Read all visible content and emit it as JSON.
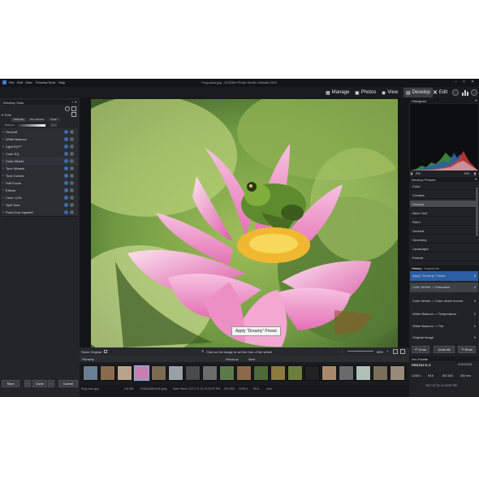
{
  "window": {
    "title": "Frog-lotus.jpg - ACDSee Photo Studio Ultimate 2021",
    "menus": [
      "File",
      "Edit",
      "View",
      "Process",
      "Tools",
      "Help"
    ]
  },
  "modes": {
    "manage": "Manage",
    "photos": "Photos",
    "view": "View",
    "develop": "Develop",
    "edit": "Edit"
  },
  "left": {
    "panel_title": "Develop Tools",
    "tune_label": "Tune",
    "tabs": [
      "Whitebal",
      "Tone Wheels",
      "Detail"
    ],
    "slider_label": "Brilliance",
    "tools": [
      "General",
      "White Balance",
      "Light EQ™",
      "Color EQ",
      "Color Wheel",
      "Tone Wheels",
      "Tone Curves",
      "Soft Focus",
      "Effects",
      "Color LUTs",
      "Split Tone",
      "Post-Crop Vignette"
    ],
    "buttons": {
      "save": "Save",
      "done": "Done",
      "cancel": "Cancel"
    }
  },
  "center": {
    "show_original": "Show Original",
    "hint": "Click on the image to set the hue of the wheel",
    "zoom": "66%",
    "tooltip": "Apply \"Dreamy\" Preset",
    "filmstrip_label": "Filmstrip",
    "filmstrip_nav": [
      "Previous",
      "Next"
    ],
    "status_file": "Frog-lotus.jpg",
    "status_items": [
      "3.8 MB",
      "5184x3456x24b jpeg",
      "Date Taken: 2017-07-31 12:34:57 PM",
      "ISO 800",
      "1/250 s",
      "f/5.6",
      "Auto"
    ]
  },
  "right": {
    "histogram_title": "Histogram",
    "hist_left": "0%",
    "hist_right": "0%",
    "presets_title": "Develop Presets",
    "presets": [
      {
        "label": "Color",
        "selected": false
      },
      {
        "label": "Creative",
        "selected": false
      },
      {
        "label": "Dreamy",
        "selected": true
      },
      {
        "label": "Neon York",
        "selected": false
      },
      {
        "label": "Retro",
        "selected": false
      },
      {
        "label": "General",
        "selected": false
      },
      {
        "label": "Geometry",
        "selected": false
      },
      {
        "label": "Landscape",
        "selected": false
      },
      {
        "label": "Portrait",
        "selected": false
      }
    ],
    "history_tabs": [
      "History",
      "Snapshots"
    ],
    "history": [
      {
        "label": "Apply \"Dreamy\" Preset",
        "num": "5",
        "state": "active"
      },
      {
        "label": "Color Wheel -> Saturation",
        "num": "4",
        "state": "sel"
      },
      {
        "label": "Color Wheel -> Color wheel moved",
        "num": "3",
        "state": "normal"
      },
      {
        "label": "White Balance -> Temperature",
        "num": "2",
        "state": "normal"
      },
      {
        "label": "White Balance -> Tint",
        "num": "1",
        "state": "normal"
      },
      {
        "label": "Original Image",
        "num": "0",
        "state": "normal"
      }
    ],
    "undo": "Undo",
    "undo_all": "Undo All",
    "redo": "Redo",
    "info_title": "Info Palette",
    "camera": "PENTAX K-3",
    "info_lines": [
      "1/250 s",
      "f/5.6",
      "ISO 800",
      "300 mm"
    ],
    "date": "2017-07-31 12:34:57 PM",
    "dims": "5184x3456"
  }
}
